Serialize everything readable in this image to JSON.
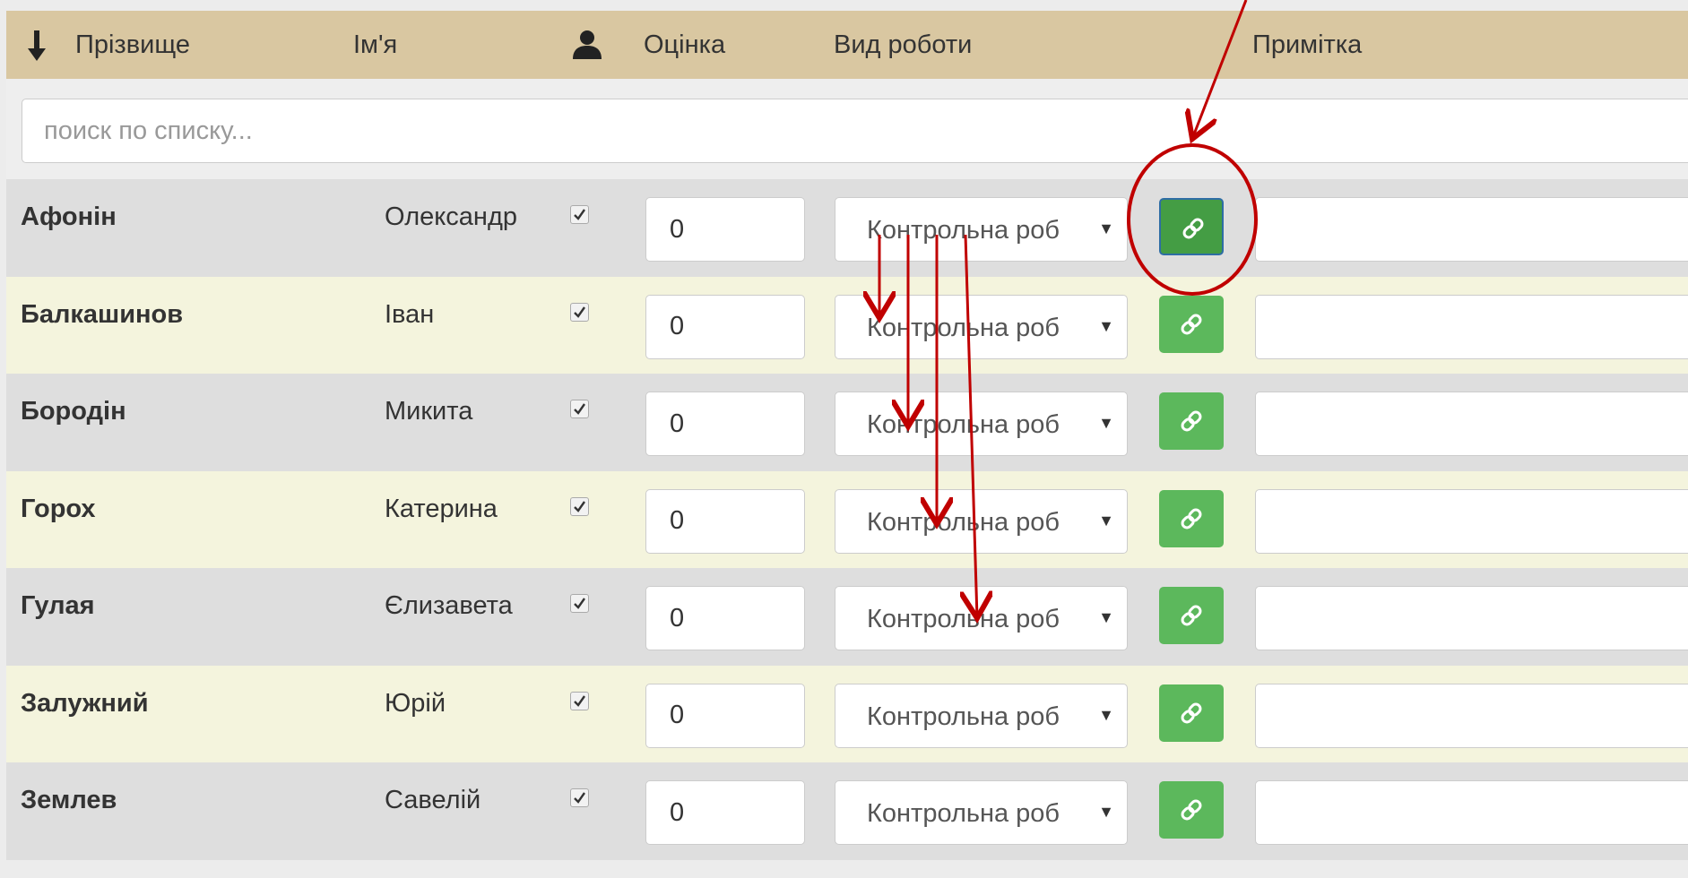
{
  "header": {
    "sort_icon": "arrow-down-icon",
    "surname": "Прізвище",
    "first_name": "Ім'я",
    "presence_icon": "user-icon",
    "grade": "Оцінка",
    "work_type": "Вид роботи",
    "note": "Примітка"
  },
  "search": {
    "placeholder": "поиск по списку..."
  },
  "rows": [
    {
      "surname": "Афонін",
      "first_name": "Олександр",
      "present": true,
      "grade": "0",
      "work_type": "Контрольна роб",
      "link_active": true,
      "note": ""
    },
    {
      "surname": "Балкашинов",
      "first_name": "Іван",
      "present": true,
      "grade": "0",
      "work_type": "Контрольна роб",
      "link_active": false,
      "note": ""
    },
    {
      "surname": "Бородін",
      "first_name": "Микита",
      "present": true,
      "grade": "0",
      "work_type": "Контрольна роб",
      "link_active": false,
      "note": ""
    },
    {
      "surname": "Горох",
      "first_name": "Катерина",
      "present": true,
      "grade": "0",
      "work_type": "Контрольна роб",
      "link_active": false,
      "note": ""
    },
    {
      "surname": "Гулая",
      "first_name": "Єлизавета",
      "present": true,
      "grade": "0",
      "work_type": "Контрольна роб",
      "link_active": false,
      "note": ""
    },
    {
      "surname": "Залужний",
      "first_name": "Юрій",
      "present": true,
      "grade": "0",
      "work_type": "Контрольна роб",
      "link_active": false,
      "note": ""
    },
    {
      "surname": "Землев",
      "first_name": "Савелій",
      "present": true,
      "grade": "0",
      "work_type": "Контрольна роб",
      "link_active": false,
      "note": ""
    }
  ],
  "colors": {
    "header_bg": "#d9c7a1",
    "row_odd": "#dedede",
    "row_even": "#f4f4dd",
    "link_button": "#5cb85c",
    "annotation": "#c00000"
  }
}
